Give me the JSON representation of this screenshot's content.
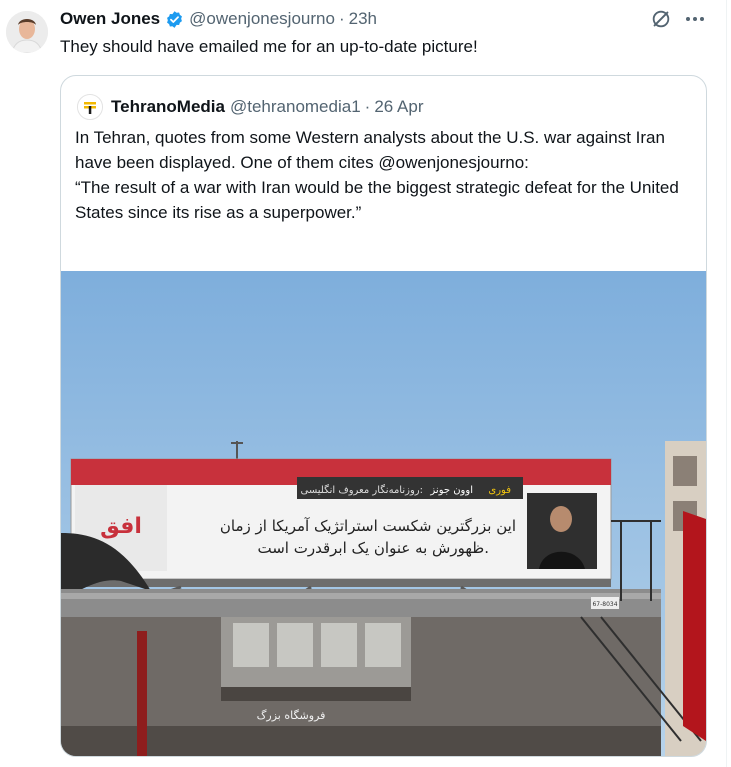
{
  "tweet": {
    "author_name": "Owen Jones",
    "author_handle": "@owenjonesjourno",
    "separator": "·",
    "time": "23h",
    "text": "They should have emailed me for an up-to-date picture!"
  },
  "quoted": {
    "author_name": "TehranoMedia",
    "author_handle": "@tehranomedia1",
    "separator": "·",
    "date": "26 Apr",
    "text_lines": [
      "In Tehran, quotes from some Western analysts about the U.S. war against Iran have been displayed. One of them cites @owenjonesjourno:",
      "“The result of a war with Iran would be the biggest strategic defeat for the United States since its rise as a superpower.”"
    ]
  },
  "billboard": {
    "headline_red": "فوری",
    "headline_name": "اوون جونز",
    "headline_rest": "روزنامه‌نگار معروف انگلیسی:",
    "quote_line1": "این بزرگترین شکست استراتژیک آمریکا از زمان",
    "quote_line2": "ظهورش به عنوان یک ابرقدرت است.",
    "logo_text": "افق",
    "sign_text": "فروشگاه بزرگ",
    "plate_text": "67-8034"
  },
  "colors": {
    "verified": "#1d9bf0",
    "secondary_text": "#536471",
    "border": "#cfd9de",
    "billboard_red": "#c8313c",
    "sky": "#8cb8de"
  },
  "icons": {
    "verified": "verified-badge-icon",
    "grok": "grok-icon",
    "more": "more-icon"
  }
}
